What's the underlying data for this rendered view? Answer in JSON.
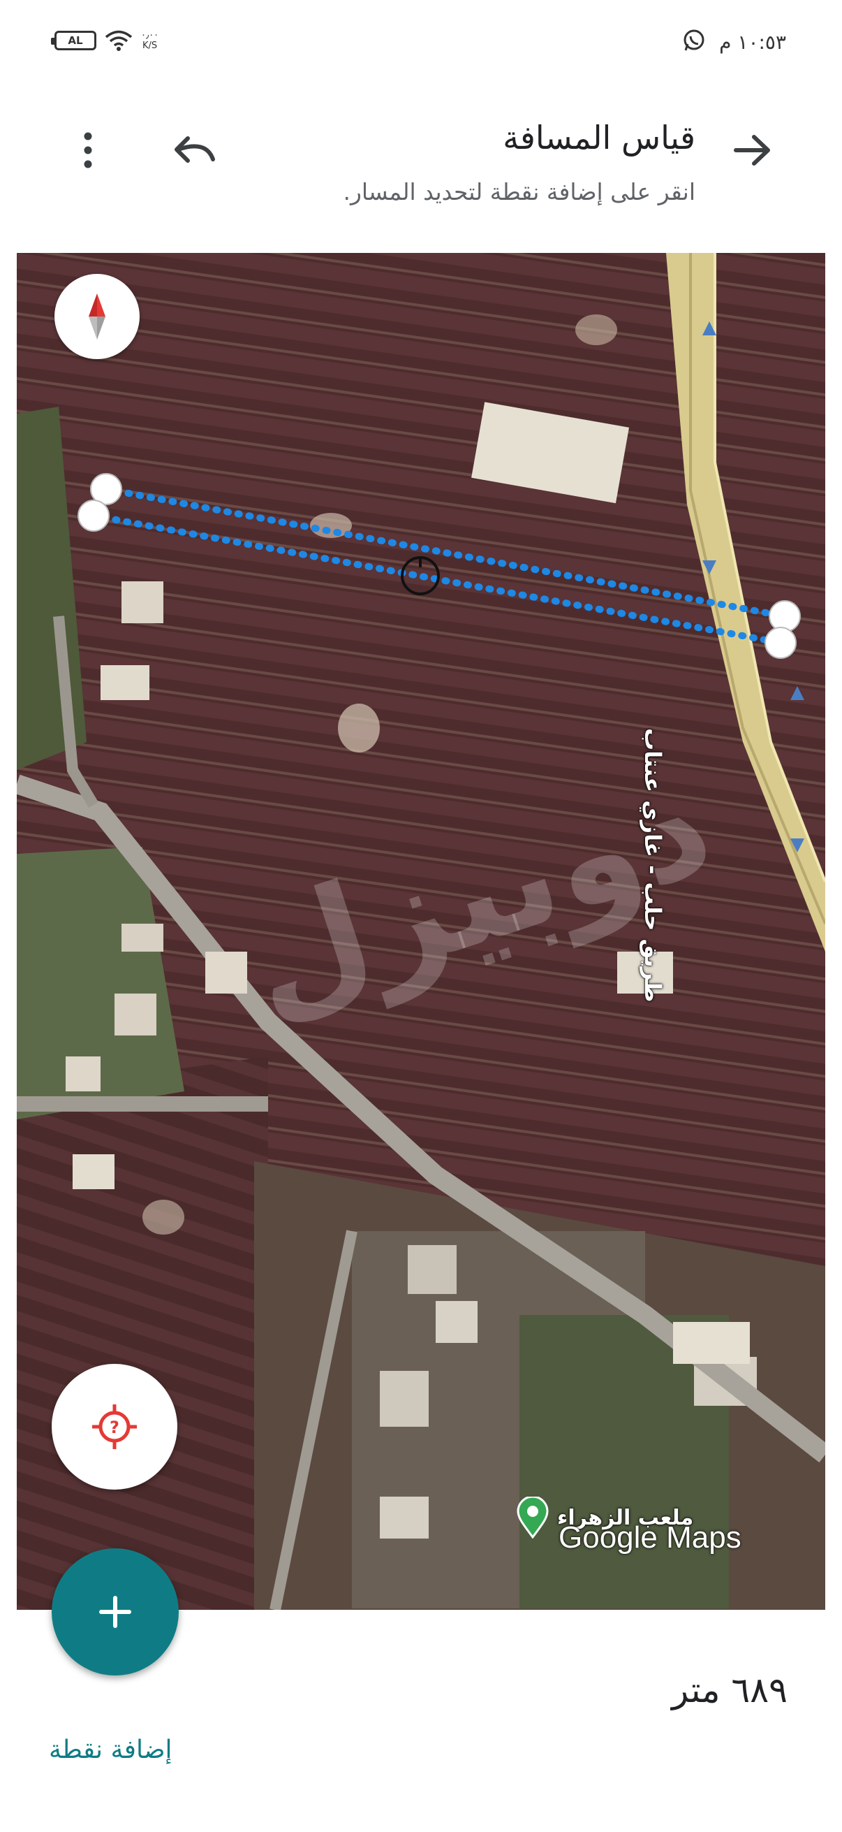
{
  "status_bar": {
    "time": "١٠:٥٣ م",
    "battery": "AL",
    "speed_value": "٠٫٠٠",
    "speed_unit": "K/S"
  },
  "header": {
    "title": "قياس المسافة",
    "subtitle": "انقر على إضافة نقطة لتحديد المسار."
  },
  "map": {
    "road_label": "طريق حلب - غازي عنتاب",
    "place_label": "ملعب الزهراء",
    "attribution": "Google Maps",
    "watermark": "دوبيزل"
  },
  "measurement": {
    "distance": "٦٨٩ متر",
    "add_point_label": "إضافة نقطة"
  },
  "colors": {
    "accent": "#0f7c85",
    "measure_line": "#1e88e5",
    "compass_needle": "#e53935",
    "locate_icon": "#e53935"
  }
}
